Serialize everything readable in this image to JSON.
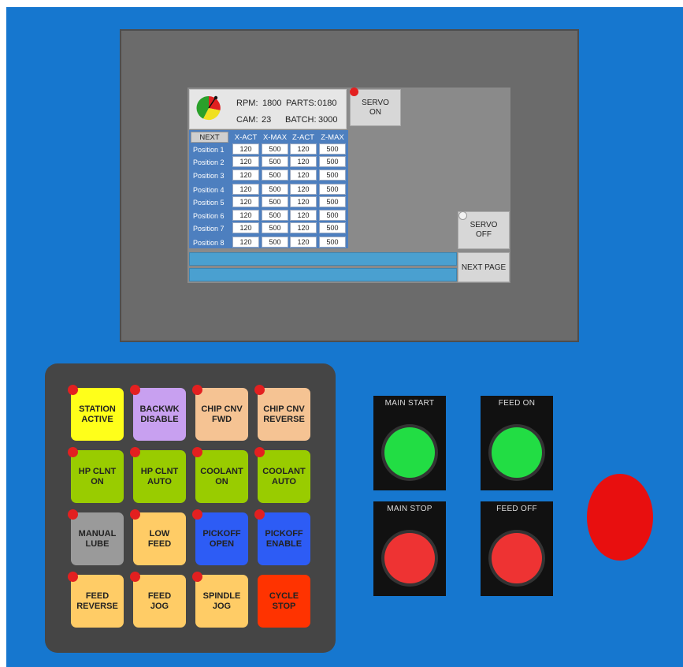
{
  "status": {
    "rpm_label": "RPM:",
    "rpm_value": "1800",
    "parts_label": "PARTS:",
    "parts_value": "0180",
    "cam_label": "CAM:",
    "cam_value": "23",
    "batch_label": "BATCH:",
    "batch_value": "3000"
  },
  "servo_on": {
    "line1": "SERVO",
    "line2": "ON"
  },
  "servo_off": {
    "line1": "SERVO",
    "line2": "OFF"
  },
  "next_page_label": "NEXT PAGE",
  "table": {
    "next_label": "NEXT",
    "columns": [
      "X-ACT",
      "X-MAX",
      "Z-ACT",
      "Z-MAX"
    ],
    "rows": [
      {
        "label": "Position 1",
        "values": [
          "120",
          "500",
          "120",
          "500"
        ]
      },
      {
        "label": "Position 2",
        "values": [
          "120",
          "500",
          "120",
          "500"
        ]
      },
      {
        "label": "Position 3",
        "values": [
          "120",
          "500",
          "120",
          "500"
        ]
      },
      {
        "label": "Position 4",
        "values": [
          "120",
          "500",
          "120",
          "500"
        ]
      },
      {
        "label": "Position 5",
        "values": [
          "120",
          "500",
          "120",
          "500"
        ]
      },
      {
        "label": "Position 6",
        "values": [
          "120",
          "500",
          "120",
          "500"
        ]
      },
      {
        "label": "Position 7",
        "values": [
          "120",
          "500",
          "120",
          "500"
        ]
      },
      {
        "label": "Position 8",
        "values": [
          "120",
          "500",
          "120",
          "500"
        ]
      }
    ]
  },
  "keypad": [
    {
      "line1": "STATION",
      "line2": "ACTIVE",
      "color": "#ffff1a"
    },
    {
      "line1": "BACKWK",
      "line2": "DISABLE",
      "color": "#c8a0f0"
    },
    {
      "line1": "CHIP CNV",
      "line2": "FWD",
      "color": "#f5c393"
    },
    {
      "line1": "CHIP CNV",
      "line2": "REVERSE",
      "color": "#f5c393"
    },
    {
      "line1": "HP CLNT",
      "line2": "ON",
      "color": "#99cc00"
    },
    {
      "line1": "HP CLNT",
      "line2": "AUTO",
      "color": "#99cc00"
    },
    {
      "line1": "COOLANT",
      "line2": "ON",
      "color": "#99cc00"
    },
    {
      "line1": "COOLANT",
      "line2": "AUTO",
      "color": "#99cc00"
    },
    {
      "line1": "MANUAL",
      "line2": "LUBE",
      "color": "#9a9a9a"
    },
    {
      "line1": "LOW",
      "line2": "FEED",
      "color": "#ffcc66"
    },
    {
      "line1": "PICKOFF",
      "line2": "OPEN",
      "color": "#2d5cf5"
    },
    {
      "line1": "PICKOFF",
      "line2": "ENABLE",
      "color": "#2d5cf5"
    },
    {
      "line1": "FEED",
      "line2": "REVERSE",
      "color": "#ffcc66"
    },
    {
      "line1": "FEED",
      "line2": "JOG",
      "color": "#ffcc66"
    },
    {
      "line1": "SPINDLE",
      "line2": "JOG",
      "color": "#ffcc66"
    },
    {
      "line1": "CYCLE",
      "line2": "STOP",
      "color": "#ff3300"
    }
  ],
  "pushbuttons": [
    {
      "label": "MAIN START",
      "color": "#22dd44"
    },
    {
      "label": "FEED ON",
      "color": "#22dd44"
    },
    {
      "label": "MAIN STOP",
      "color": "#ee3333"
    },
    {
      "label": "FEED OFF",
      "color": "#ee3333"
    }
  ],
  "colors": {
    "panel": "#1677cf",
    "estop": "#e80f0f",
    "led_red": "#e32020"
  }
}
